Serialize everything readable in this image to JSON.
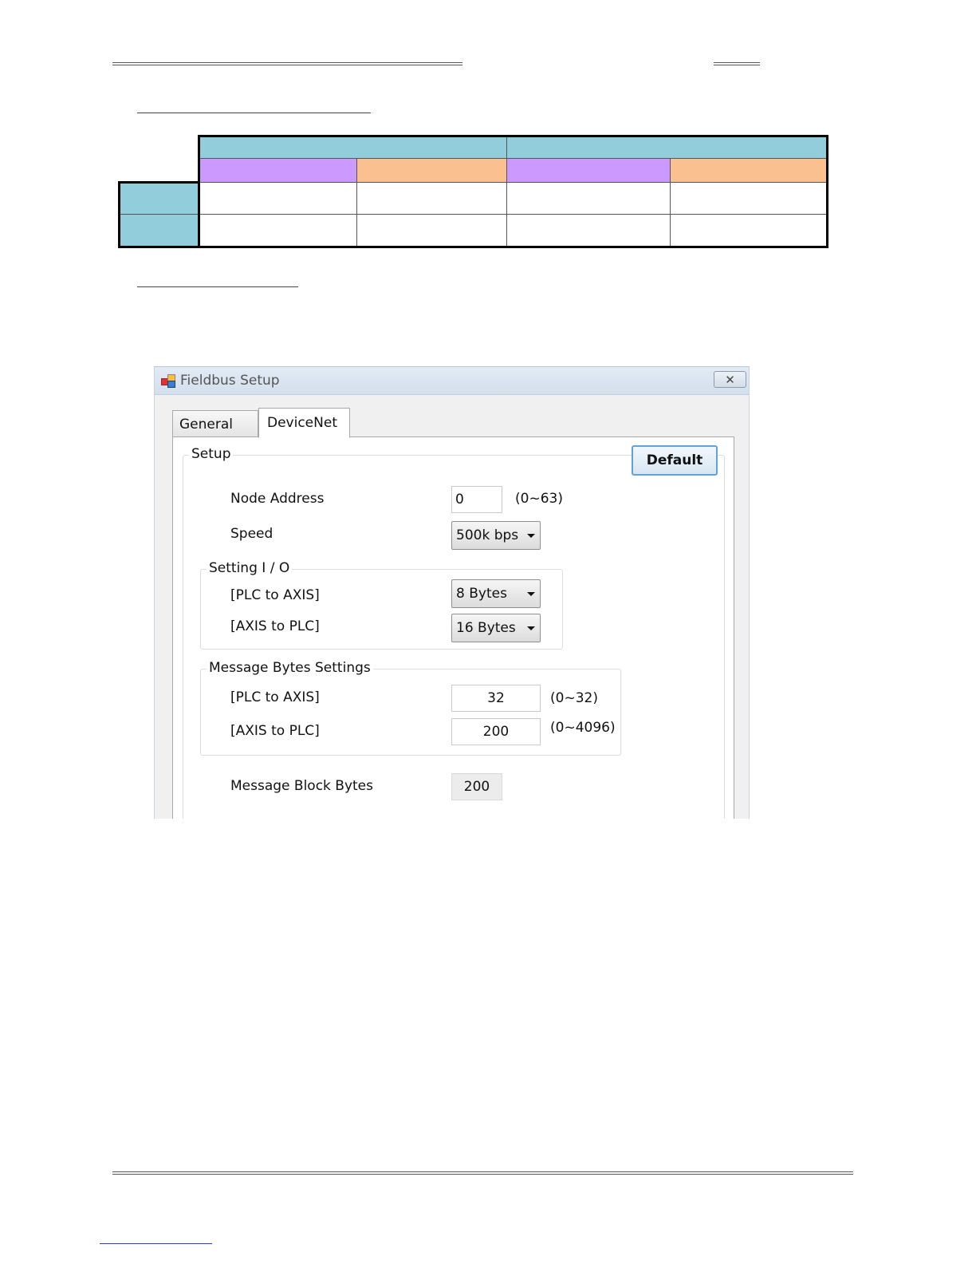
{
  "dialog": {
    "title": "Fieldbus Setup",
    "tabs": [
      {
        "label": "General"
      },
      {
        "label": "DeviceNet"
      }
    ],
    "default_button": "Default",
    "setup_group": "Setup",
    "node_address": {
      "label": "Node Address",
      "value": "0",
      "range": "(0~63)"
    },
    "speed": {
      "label": "Speed",
      "value": "500k bps"
    },
    "setting_io": {
      "title": "Setting I / O",
      "plc_to_axis": {
        "label": "[PLC to AXIS]",
        "value": "8 Bytes"
      },
      "axis_to_plc": {
        "label": "[AXIS to PLC]",
        "value": "16 Bytes"
      }
    },
    "message_bytes": {
      "title": "Message Bytes Settings",
      "plc_to_axis": {
        "label": "[PLC to AXIS]",
        "value": "32",
        "range": "(0~32)"
      },
      "axis_to_plc": {
        "label": "[AXIS to PLC]",
        "value": "200",
        "range": "(0~4096)"
      }
    },
    "message_block": {
      "label": "Message Block Bytes",
      "value": "200"
    }
  },
  "colors": {
    "header_blue": "#92cddc",
    "header_purple": "#cc99ff",
    "header_orange": "#fac090"
  }
}
